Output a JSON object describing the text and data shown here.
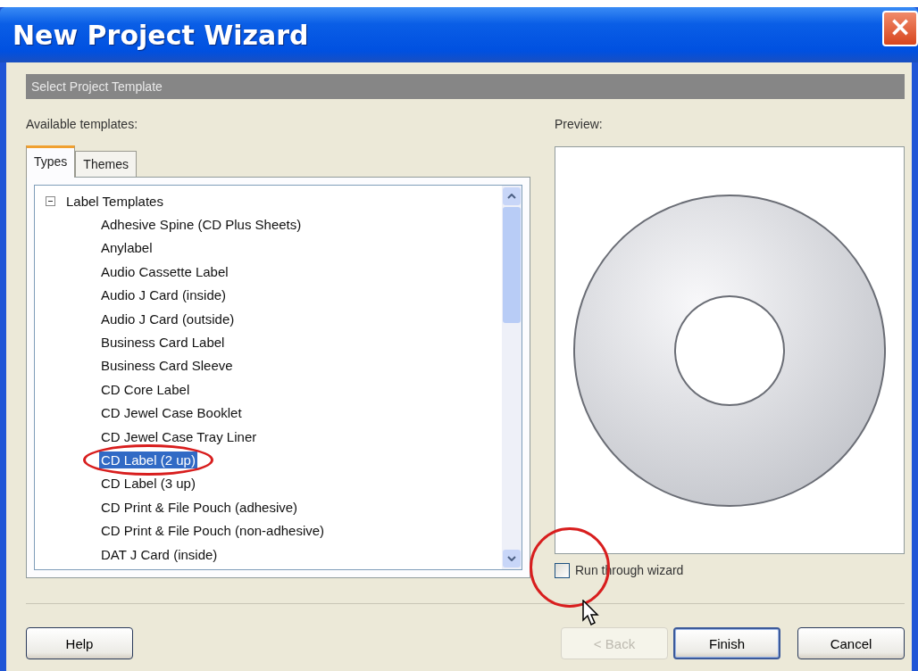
{
  "window": {
    "title": "New Project Wizard",
    "close": "×"
  },
  "header": "Select Project Template",
  "templates_label": "Available templates:",
  "tabs": [
    {
      "label": "Types",
      "selected": true
    },
    {
      "label": "Themes",
      "selected": false
    }
  ],
  "tree": [
    {
      "label": "Label Templates",
      "expanded": true,
      "children": [
        {
          "label": "Adhesive Spine (CD Plus Sheets)",
          "selected": false,
          "circled": false
        },
        {
          "label": "Anylabel",
          "selected": false,
          "circled": false
        },
        {
          "label": "Audio Cassette Label",
          "selected": false,
          "circled": false
        },
        {
          "label": "Audio J Card (inside)",
          "selected": false,
          "circled": false
        },
        {
          "label": "Audio J Card (outside)",
          "selected": false,
          "circled": false
        },
        {
          "label": "Business Card Label",
          "selected": false,
          "circled": false
        },
        {
          "label": "Business Card Sleeve",
          "selected": false,
          "circled": false
        },
        {
          "label": "CD Core Label",
          "selected": false,
          "circled": false
        },
        {
          "label": "CD Jewel Case Booklet",
          "selected": false,
          "circled": false
        },
        {
          "label": "CD Jewel Case Tray Liner",
          "selected": false,
          "circled": false
        },
        {
          "label": "CD Label (2 up)",
          "selected": true,
          "circled": true
        },
        {
          "label": "CD Label (3 up)",
          "selected": false,
          "circled": false
        },
        {
          "label": "CD Print & File Pouch (adhesive)",
          "selected": false,
          "circled": false
        },
        {
          "label": "CD Print & File Pouch (non-adhesive)",
          "selected": false,
          "circled": false
        },
        {
          "label": "DAT J Card (inside)",
          "selected": false,
          "circled": false
        }
      ]
    }
  ],
  "preview_label": "Preview:",
  "run_wizard": {
    "label": "Run through wizard",
    "checked": false,
    "circled": true
  },
  "buttons": [
    {
      "label": "Help",
      "disabled": false,
      "default": false
    },
    {
      "label": "< Back",
      "disabled": true,
      "default": false
    },
    {
      "label": "Finish",
      "disabled": false,
      "default": true
    },
    {
      "label": "Cancel",
      "disabled": false,
      "default": false
    }
  ]
}
